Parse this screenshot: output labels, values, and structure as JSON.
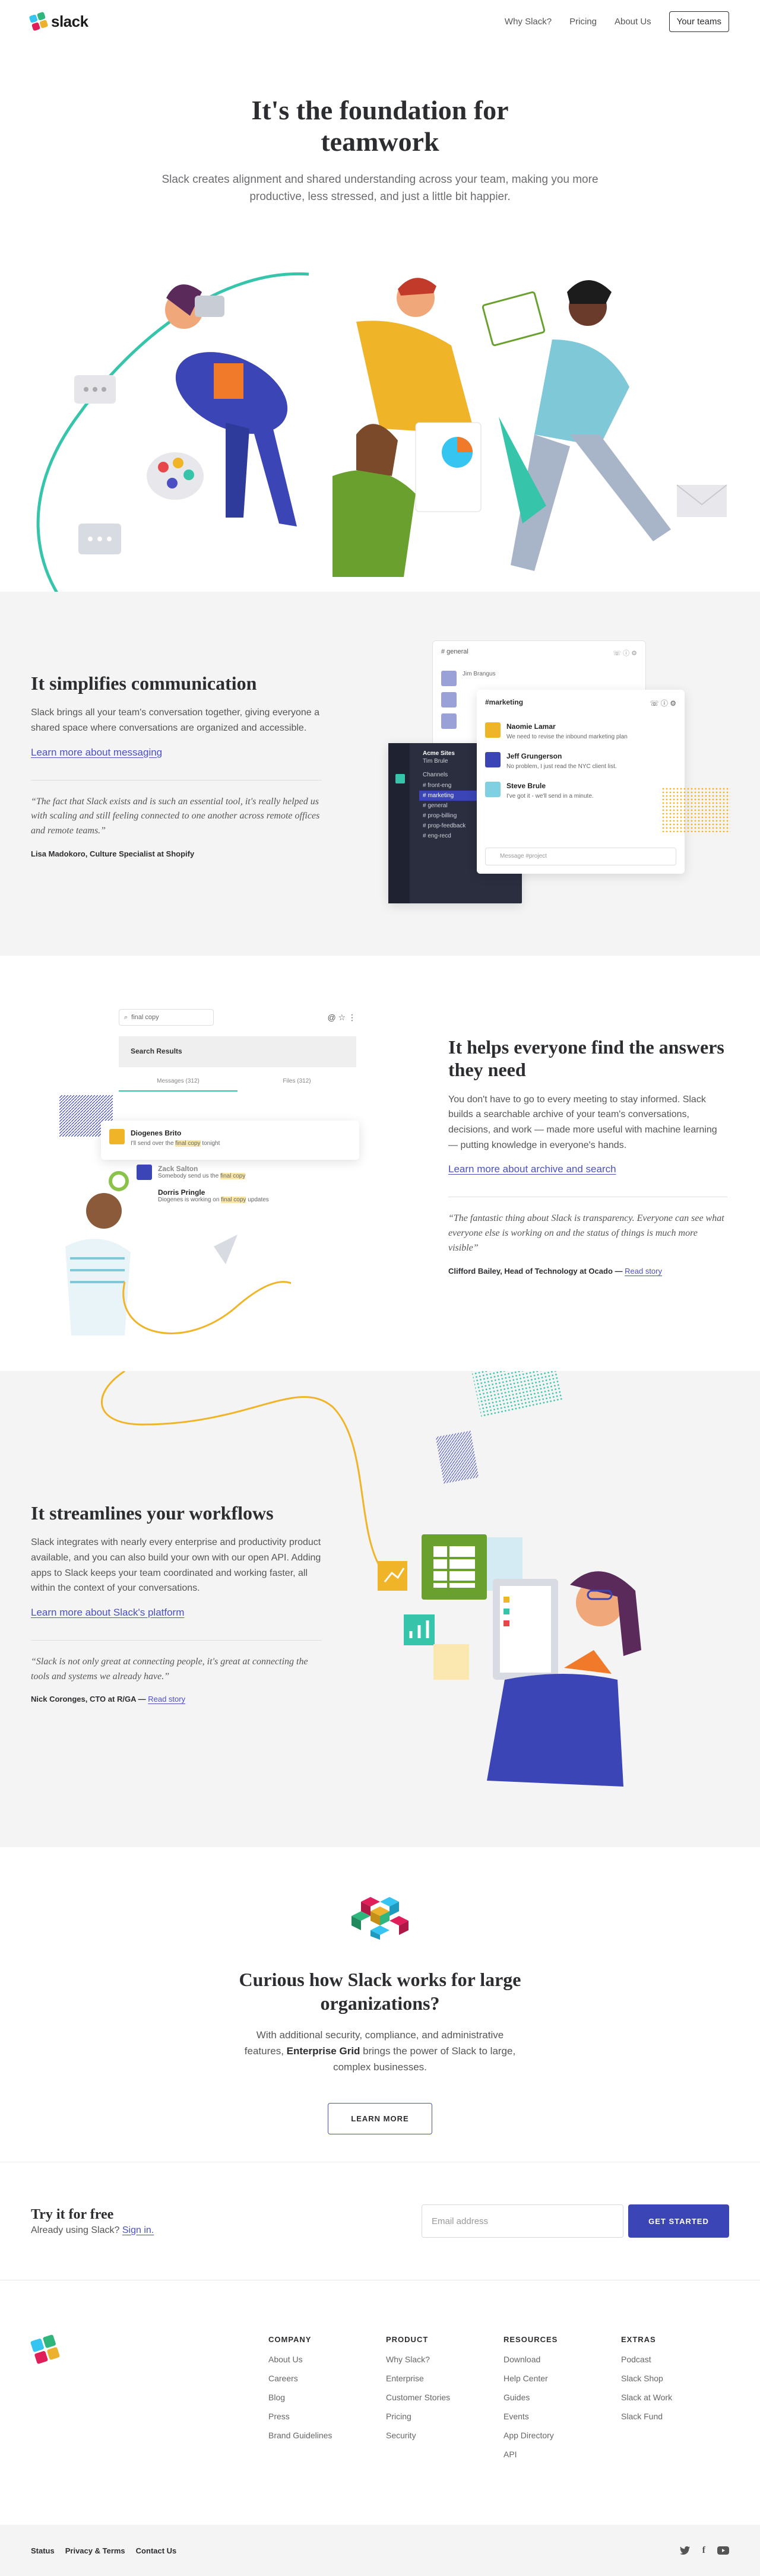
{
  "nav": {
    "brand": "slack",
    "links": [
      "Why Slack?",
      "Pricing",
      "About Us"
    ],
    "your_teams": "Your teams"
  },
  "hero": {
    "title": "It's the foundation for teamwork",
    "subtitle": "Slack creates alignment and shared understanding across your team, making you more productive, less stressed, and just a little bit happier."
  },
  "communication": {
    "title": "It simplifies communication",
    "body": "Slack brings all your team's conversation together, giving everyone a shared space where conversations are organized and accessible.",
    "link": "Learn more about messaging",
    "quote": "“The fact that Slack exists and is such an essential tool, it's really helped us with scaling and still feeling connected to one another across remote offices and remote teams.”",
    "cite": "Lisa Madokoro, Culture Specialist at Shopify",
    "mock": {
      "back_channel": "# general",
      "back_user": "Jim Brangus",
      "channel": "#marketing",
      "messages": [
        {
          "name": "Naomie Lamar",
          "text": "We need to revise the inbound marketing plan"
        },
        {
          "name": "Jeff Grungerson",
          "text": "No problem, I just read the NYC client list."
        },
        {
          "name": "Steve Brule",
          "text": "I've got it - we'll send in a minute."
        }
      ],
      "input": "Message #project",
      "sidebar_team": "Acme Sites",
      "sidebar_user": "Tim Brule",
      "sidebar_head": "Channels",
      "sidebar_channels": [
        "# front-eng",
        "# marketing",
        "# general",
        "# prop-billing",
        "# prop-feedback",
        "# eng-recd"
      ]
    }
  },
  "search": {
    "title": "It helps everyone find the answers they need",
    "body": "You don't have to go to every meeting to stay informed. Slack builds a searchable archive of your team's conversations, decisions, and work — made more useful with machine learning — putting knowledge in everyone's hands.",
    "link": "Learn more about archive and search",
    "quote": "“The fantastic thing about Slack is transparency. Everyone can see what everyone else is working on and the status of things is much more visible”",
    "cite": "Clifford Bailey, Head of Technology at Ocado —",
    "cite_link": "Read story",
    "mock": {
      "query": "final copy",
      "results_title": "Search Results",
      "tab_messages": "Messages (312)",
      "tab_files": "Files (312)",
      "r1_name": "Diogenes Brito",
      "r1_pre": "I'll send over the ",
      "r1_hl": "final copy",
      "r1_post": " tonight",
      "r2_name": "Zack Salton",
      "r2_pre": "Somebody send us the ",
      "r2_hl": "final copy",
      "r3_name": "Dorris Pringle",
      "r3_pre": "Diogenes is working on ",
      "r3_hl": "final copy",
      "r3_post": " updates"
    }
  },
  "workflows": {
    "title": "It streamlines your workflows",
    "body": "Slack integrates with nearly every enterprise and productivity product available, and you can also build your own with our open API. Adding apps to Slack keeps your team coordinated and working faster, all within the context of your conversations.",
    "link": "Learn more about Slack's platform",
    "quote": "“Slack is not only great at connecting people, it's great at connecting the tools and systems we already have.”",
    "cite": "Nick Coronges, CTO at R/GA —",
    "cite_link": "Read story"
  },
  "enterprise": {
    "title": "Curious how Slack works for large organizations?",
    "body_pre": "With additional security, compliance, and administrative features, ",
    "body_strong": "Enterprise Grid",
    "body_post": " brings the power of Slack to large, complex businesses.",
    "button": "LEARN MORE"
  },
  "try": {
    "title": "Try it for free",
    "sub": "Already using Slack?",
    "signin": "Sign in.",
    "placeholder": "Email address",
    "button": "GET STARTED"
  },
  "footer": {
    "columns": [
      {
        "title": "COMPANY",
        "items": [
          "About Us",
          "Careers",
          "Blog",
          "Press",
          "Brand Guidelines"
        ]
      },
      {
        "title": "PRODUCT",
        "items": [
          "Why Slack?",
          "Enterprise",
          "Customer Stories",
          "Pricing",
          "Security"
        ]
      },
      {
        "title": "RESOURCES",
        "items": [
          "Download",
          "Help Center",
          "Guides",
          "Events",
          "App Directory",
          "API"
        ]
      },
      {
        "title": "EXTRAS",
        "items": [
          "Podcast",
          "Slack Shop",
          "Slack at Work",
          "Slack Fund"
        ]
      }
    ],
    "bottom_links": [
      "Status",
      "Privacy & Terms",
      "Contact Us"
    ]
  },
  "colors": {
    "accent": "#3b45b5",
    "link": "#4a4fc4",
    "yellow": "#f0b429",
    "teal": "#36c5ab",
    "green": "#6aa12e",
    "navy": "#2f3b9a"
  },
  "icons": [
    "search-icon",
    "at-icon",
    "star-icon",
    "more-icon",
    "twitter-icon",
    "facebook-icon",
    "youtube-icon"
  ]
}
